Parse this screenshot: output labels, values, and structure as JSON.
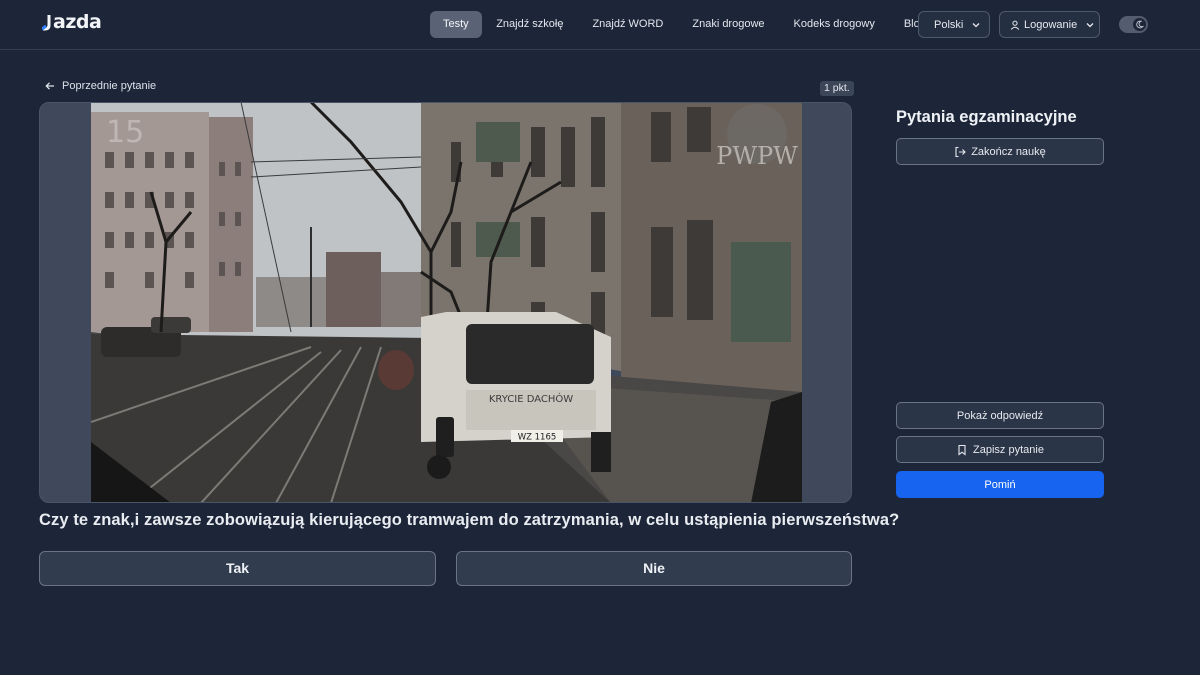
{
  "header": {
    "logo_text": "azda",
    "nav": [
      "Testy",
      "Znajdź szkołę",
      "Znajdź WORD",
      "Znaki drogowe",
      "Kodeks drogowy",
      "Blog"
    ],
    "active_nav": "Testy",
    "language_label": "Polski",
    "login_label": "Logowanie",
    "theme": "dark"
  },
  "question_area": {
    "back_label": "Poprzednie pytanie",
    "points_badge": "1 pkt.",
    "media": {
      "watermark": "PWPW",
      "van_lettering": "KRYCIE DACHÓW",
      "plate": "WZ 1165"
    },
    "question_text": "Czy te znak,i zawsze zobowiązują kierującego tramwajem do zatrzymania, w celu ustąpienia pierwszeństwa?",
    "answers": [
      "Tak",
      "Nie"
    ]
  },
  "sidebar": {
    "title": "Pytania egzaminacyjne",
    "end_label": "Zakończ naukę",
    "show_answer_label": "Pokaż odpowiedź",
    "save_label": "Zapisz pytanie",
    "skip_label": "Pomiń"
  },
  "colors": {
    "background": "#1d2638",
    "primary": "#1764f0",
    "nav_active": "#5a6375"
  }
}
